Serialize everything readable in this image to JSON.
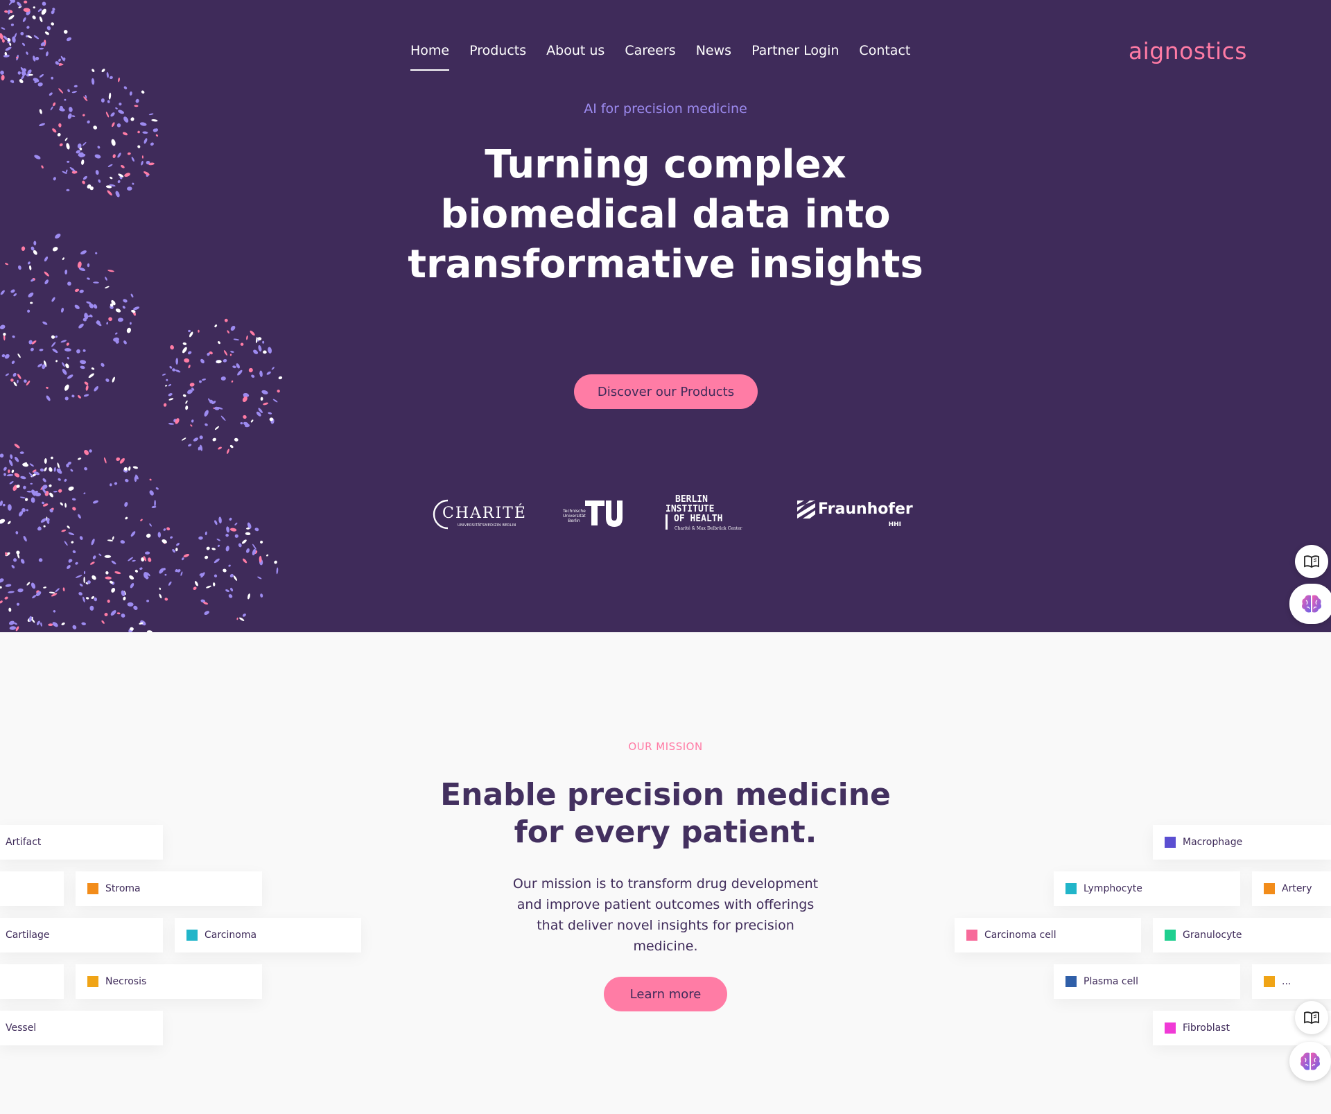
{
  "nav": {
    "items": [
      {
        "label": "Home",
        "active": true
      },
      {
        "label": "Products",
        "active": false
      },
      {
        "label": "About us",
        "active": false
      },
      {
        "label": "Careers",
        "active": false
      },
      {
        "label": "News",
        "active": false
      },
      {
        "label": "Partner Login",
        "active": false
      },
      {
        "label": "Contact",
        "active": false
      }
    ]
  },
  "logo": "aignostics",
  "hero": {
    "eyebrow": "AI for precision medicine",
    "headline": "Turning complex biomedical data into transformative insights",
    "cta": "Discover our Products"
  },
  "partners": {
    "charite": {
      "name": "CHARITÉ",
      "sub": "UNIVERSITÄTSMEDIZIN BERLIN"
    },
    "tu": {
      "line1": "Technische",
      "line2": "Universität",
      "line3": "Berlin"
    },
    "bih": {
      "line1": "BERLIN",
      "line2": "INSTITUTE",
      "line3": "OF HEALTH",
      "sub": "Charité & Max Delbrück Center"
    },
    "fraunhofer": {
      "name": "Fraunhofer",
      "sub": "HHI"
    }
  },
  "mission": {
    "eyebrow": "OUR MISSION",
    "title_line1": "Enable precision medicine",
    "title_line2": "for every patient.",
    "text": "Our mission is to transform drug development and improve patient outcomes with offerings that deliver novel insights for precision medicine.",
    "cta": "Learn more"
  },
  "tags_left": [
    {
      "label": "Artifact",
      "color": ""
    },
    {
      "label": "",
      "color": ""
    },
    {
      "label": "Stroma",
      "color": "#f28c1a"
    },
    {
      "label": "Cartilage",
      "color": ""
    },
    {
      "label": "Carcinoma",
      "color": "#21b5c9"
    },
    {
      "label": "",
      "color": ""
    },
    {
      "label": "Necrosis",
      "color": "#f0a416"
    },
    {
      "label": "Vessel",
      "color": ""
    }
  ],
  "tags_right": [
    {
      "label": "Macrophage",
      "color": "#5b4fd1"
    },
    {
      "label": "Lymphocyte",
      "color": "#21b5c9"
    },
    {
      "label": "Artery",
      "color": "#f28c1a"
    },
    {
      "label": "Carcinoma cell",
      "color": "#f76a9a"
    },
    {
      "label": "Granulocyte",
      "color": "#1fcf8f"
    },
    {
      "label": "Plasma cell",
      "color": "#2f5fa8"
    },
    {
      "label": "...",
      "color": "#f0a416"
    },
    {
      "label": "Fibroblast",
      "color": "#f03ad6"
    }
  ],
  "colors": {
    "hero_bg": "#3f2b5a",
    "accent_pink": "#ff7ca5",
    "accent_purple": "#9d8bf0",
    "page_bg": "#f9f9f9"
  },
  "icons": {
    "side_top": "book-icon",
    "side_bottom": "brain-icon"
  }
}
